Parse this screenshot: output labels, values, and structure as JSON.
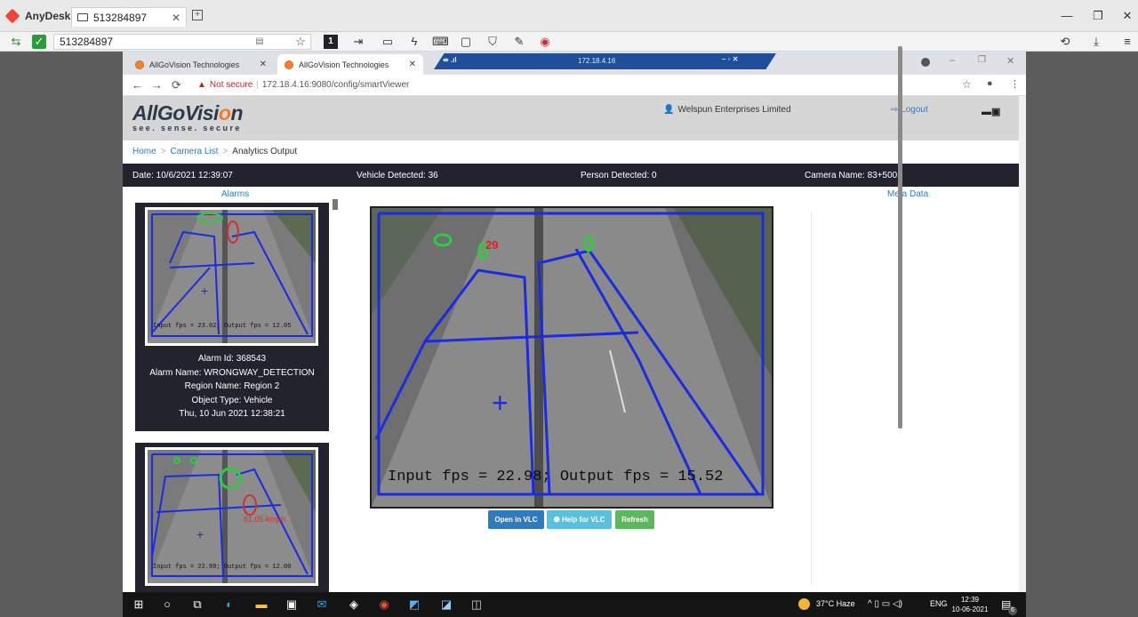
{
  "anydesk": {
    "app_name": "AnyDesk",
    "tab_label": "513284897",
    "address_value": "513284897"
  },
  "browser": {
    "tabs": [
      {
        "label": "AllGoVision Technologies"
      },
      {
        "label": "AllGoVision Technologies"
      }
    ],
    "remote_ip": "172.18.4.16",
    "not_secure": "Not secure",
    "url": "172.18.4.16:9080/config/smartViewer"
  },
  "header": {
    "brand_prefix": "AllGoVisi",
    "brand_o": "o",
    "brand_suffix": "n",
    "tagline": "see. sense. secure",
    "user": "Welspun Enterprises Limited",
    "logout": "Logout"
  },
  "breadcrumb": [
    "Home",
    "Camera List",
    "Analytics Output"
  ],
  "infobar": {
    "date": "Date: 10/6/2021 12:39:07",
    "vehicle": "Vehicle Detected: 36",
    "person": "Person Detected: 0",
    "camera": "Camera Name: 83+500"
  },
  "panels": {
    "alarms_title": "Alarms",
    "meta_title": "Meta Data"
  },
  "alarms": [
    {
      "thumb_caption": "Input fps = 23.02; Output fps = 12.05",
      "id": "Alarm Id: 368543",
      "name": "Alarm Name: WRONGWAY_DETECTION",
      "region": "Region Name: Region 2",
      "object": "Object Type: Vehicle",
      "time": "Thu, 10 Jun 2021 12:38:21"
    },
    {
      "thumb_caption": "Input fps = 22.99; Output fps = 12.00",
      "speed": "61.05 kmph"
    }
  ],
  "video": {
    "caption": "Input fps = 22.98; Output fps = 15.52",
    "track_label": "29"
  },
  "buttons": {
    "vlc": "Open in VLC",
    "help": "Help for VLC",
    "refresh": "Refresh"
  },
  "taskbar": {
    "weather": "37°C  Haze",
    "lang": "ENG",
    "time": "12:39",
    "date": "10-06-2021",
    "notif_count": "6"
  },
  "colors": {
    "accent": "#2b7bc0",
    "dark_bar": "#23232e",
    "btn_vlc": "#2f7bbd",
    "btn_help": "#5bc0de",
    "btn_refresh": "#5cb85c"
  }
}
